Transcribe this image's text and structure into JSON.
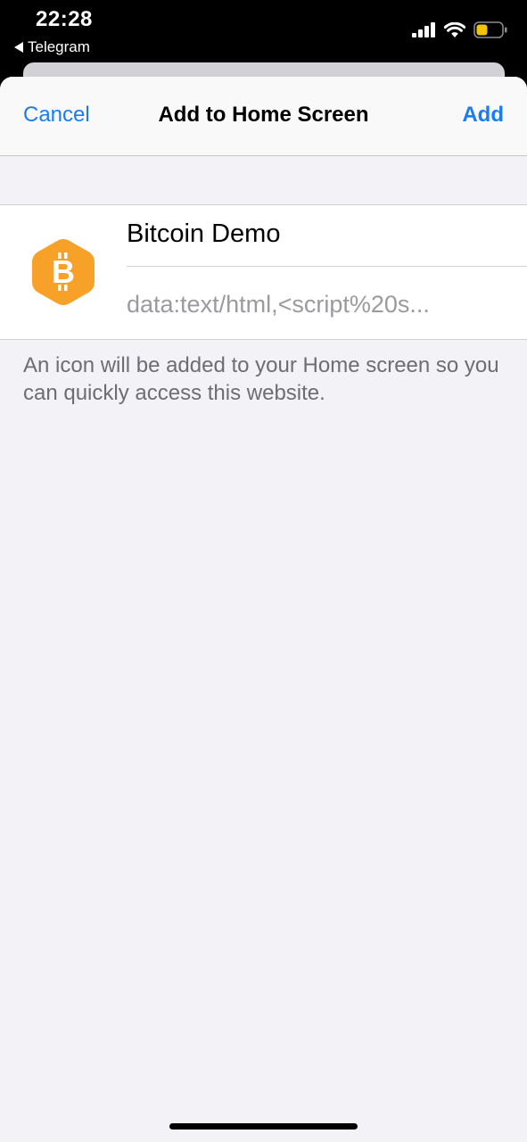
{
  "status_bar": {
    "time": "22:28",
    "back_app": "Telegram",
    "battery_color": "#f5c400"
  },
  "nav": {
    "cancel_label": "Cancel",
    "title": "Add to Home Screen",
    "add_label": "Add"
  },
  "shortcut": {
    "icon": "bitcoin-icon",
    "icon_color": "#f7a128",
    "name_value": "Bitcoin Demo",
    "url": "data:text/html,<script%20s..."
  },
  "footer": {
    "text": "An icon will be added to your Home screen so you can quickly access this website."
  },
  "colors": {
    "accent": "#1a7cf2",
    "background": "#f2f2f7"
  }
}
